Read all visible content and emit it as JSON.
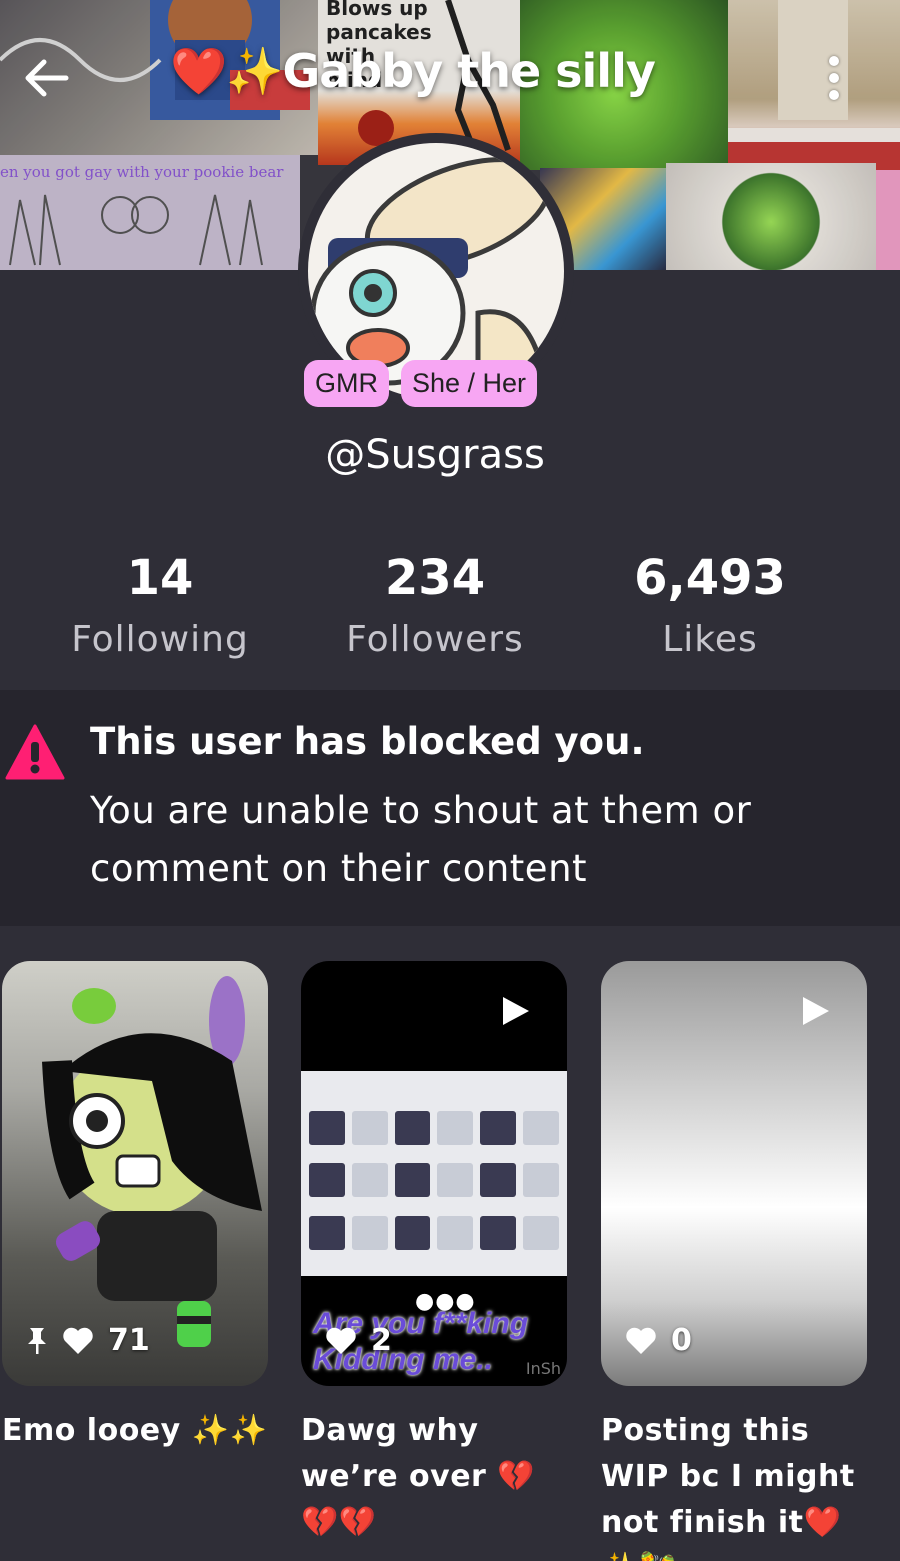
{
  "header": {
    "title": "❤️✨Gabby the silly",
    "back_icon": "arrow-left-icon",
    "more_icon": "kebab-menu-icon"
  },
  "banner": {
    "meme_text": "Blows up pancakes with mind",
    "caption_text": "en you got gay with your pookie bear"
  },
  "profile": {
    "handle": "@Susgrass",
    "badges": [
      "GMR",
      "She / Her"
    ]
  },
  "stats": {
    "following": {
      "value": "14",
      "label": "Following"
    },
    "followers": {
      "value": "234",
      "label": "Followers"
    },
    "likes": {
      "value": "6,493",
      "label": "Likes"
    }
  },
  "notice": {
    "title": "This user has blocked you.",
    "body": "You are unable to shout at them or comment on their content",
    "icon": "warning-triangle-icon",
    "icon_color": "#ff1f73"
  },
  "posts": [
    {
      "caption": "Emo looey ✨✨",
      "likes": "71",
      "pinned": true,
      "is_video": false
    },
    {
      "caption": "Dawg why we’re over 💔💔💔",
      "likes": "2",
      "pinned": false,
      "is_video": true,
      "overlay_text": "Are you f**king Kidding me..",
      "watermark": "InSh"
    },
    {
      "caption": "Posting this WIP bc I might not finish it❤️✨🪇",
      "likes": "0",
      "pinned": false,
      "is_video": true
    }
  ],
  "colors": {
    "background": "#2f2e37",
    "notice_background": "#26252d",
    "badge": "#f7a6f3",
    "secondary_text": "#c6c5cc"
  }
}
